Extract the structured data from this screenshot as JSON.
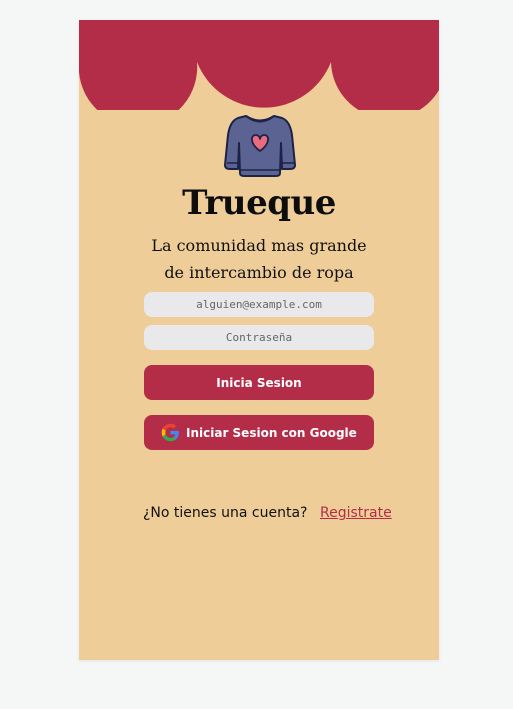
{
  "app": {
    "title": "Trueque",
    "subtitle": "La comunidad mas grande de intercambio de ropa",
    "logo_icon": "sweater-heart-icon"
  },
  "form": {
    "email_placeholder": "alguien@example.com",
    "password_placeholder": "Contraseña",
    "login_label": "Inicia Sesion",
    "google_label": "Iniciar Sesion con Google",
    "google_icon": "google-icon"
  },
  "footer": {
    "question": "¿No tienes una cuenta?",
    "register_label": "Registrate"
  },
  "colors": {
    "accent": "#b42d48",
    "background": "#eecd99",
    "input_bg": "#e9e9eb"
  }
}
